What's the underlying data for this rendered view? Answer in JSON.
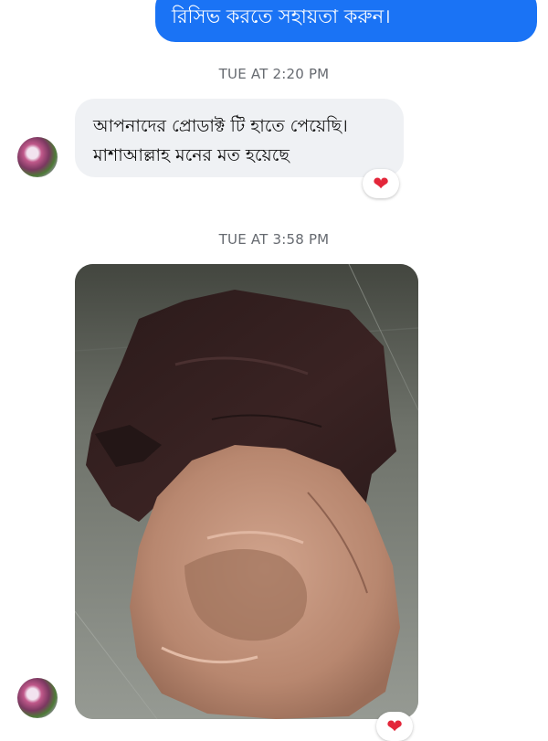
{
  "conversation": {
    "sent_message": "রিসিভ করতে সহায়তা করুন।",
    "timestamps": [
      "TUE AT 2:20 PM",
      "TUE AT 3:58 PM"
    ],
    "received_message": {
      "lines": [
        "আপনাদের প্রোডাক্ট টি হাতে পেয়েছি।",
        "মাশাআল্লাহ মনের মত হয়েছে"
      ],
      "reaction": "❤"
    },
    "photo_reaction": "❤"
  },
  "colors": {
    "sent_bubble": "#1a73f5",
    "received_bubble": "#eff1f4",
    "timestamp_text": "#666a70",
    "reaction_heart": "#e3263a"
  },
  "icons": {
    "avatar": "profile-photo-avatar",
    "reaction": "heart-icon"
  }
}
